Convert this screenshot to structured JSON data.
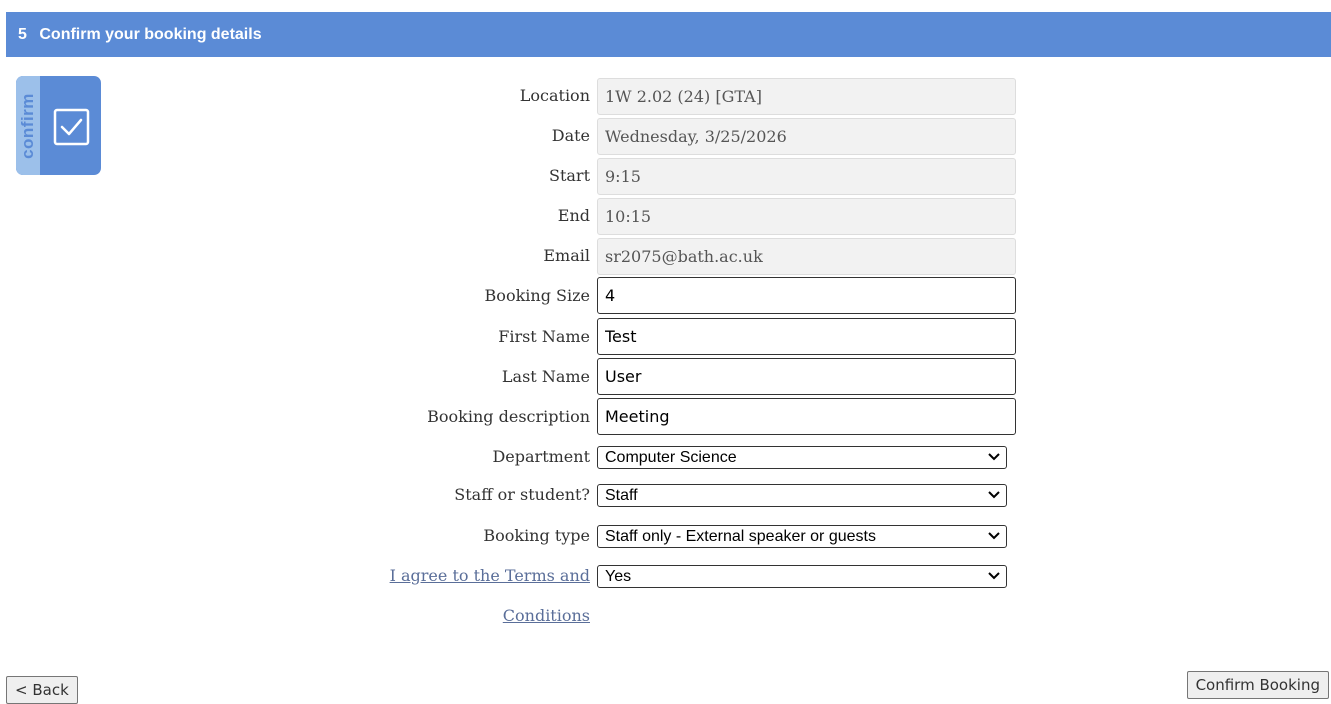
{
  "header": {
    "step": "5",
    "title": "Confirm your booking details",
    "color": "#5b8bd6"
  },
  "badge": {
    "text": "confirm",
    "icon": "checkbox-icon"
  },
  "fields": {
    "location": {
      "label": "Location",
      "value": "1W 2.02 (24) [GTA]"
    },
    "date": {
      "label": "Date",
      "value": "Wednesday, 3/25/2026"
    },
    "start": {
      "label": "Start",
      "value": "9:15"
    },
    "end": {
      "label": "End",
      "value": "10:15"
    },
    "email": {
      "label": "Email",
      "value": "sr2075@bath.ac.uk"
    },
    "booking_size": {
      "label": "Booking Size",
      "value": "4"
    },
    "first_name": {
      "label": "First Name",
      "value": "Test"
    },
    "last_name": {
      "label": "Last Name",
      "value": "User"
    },
    "booking_description": {
      "label": "Booking description",
      "value": "Meeting"
    },
    "department": {
      "label": "Department",
      "value": "Computer Science"
    },
    "staff_or_student": {
      "label": "Staff or student?",
      "value": "Staff"
    },
    "booking_type": {
      "label": "Booking type",
      "value": "Staff only - External speaker or guests"
    },
    "terms": {
      "label_line1": "I agree to the Terms and",
      "label_line2": "Conditions",
      "value": "Yes"
    }
  },
  "buttons": {
    "back": "< Back",
    "confirm": "Confirm Booking"
  }
}
